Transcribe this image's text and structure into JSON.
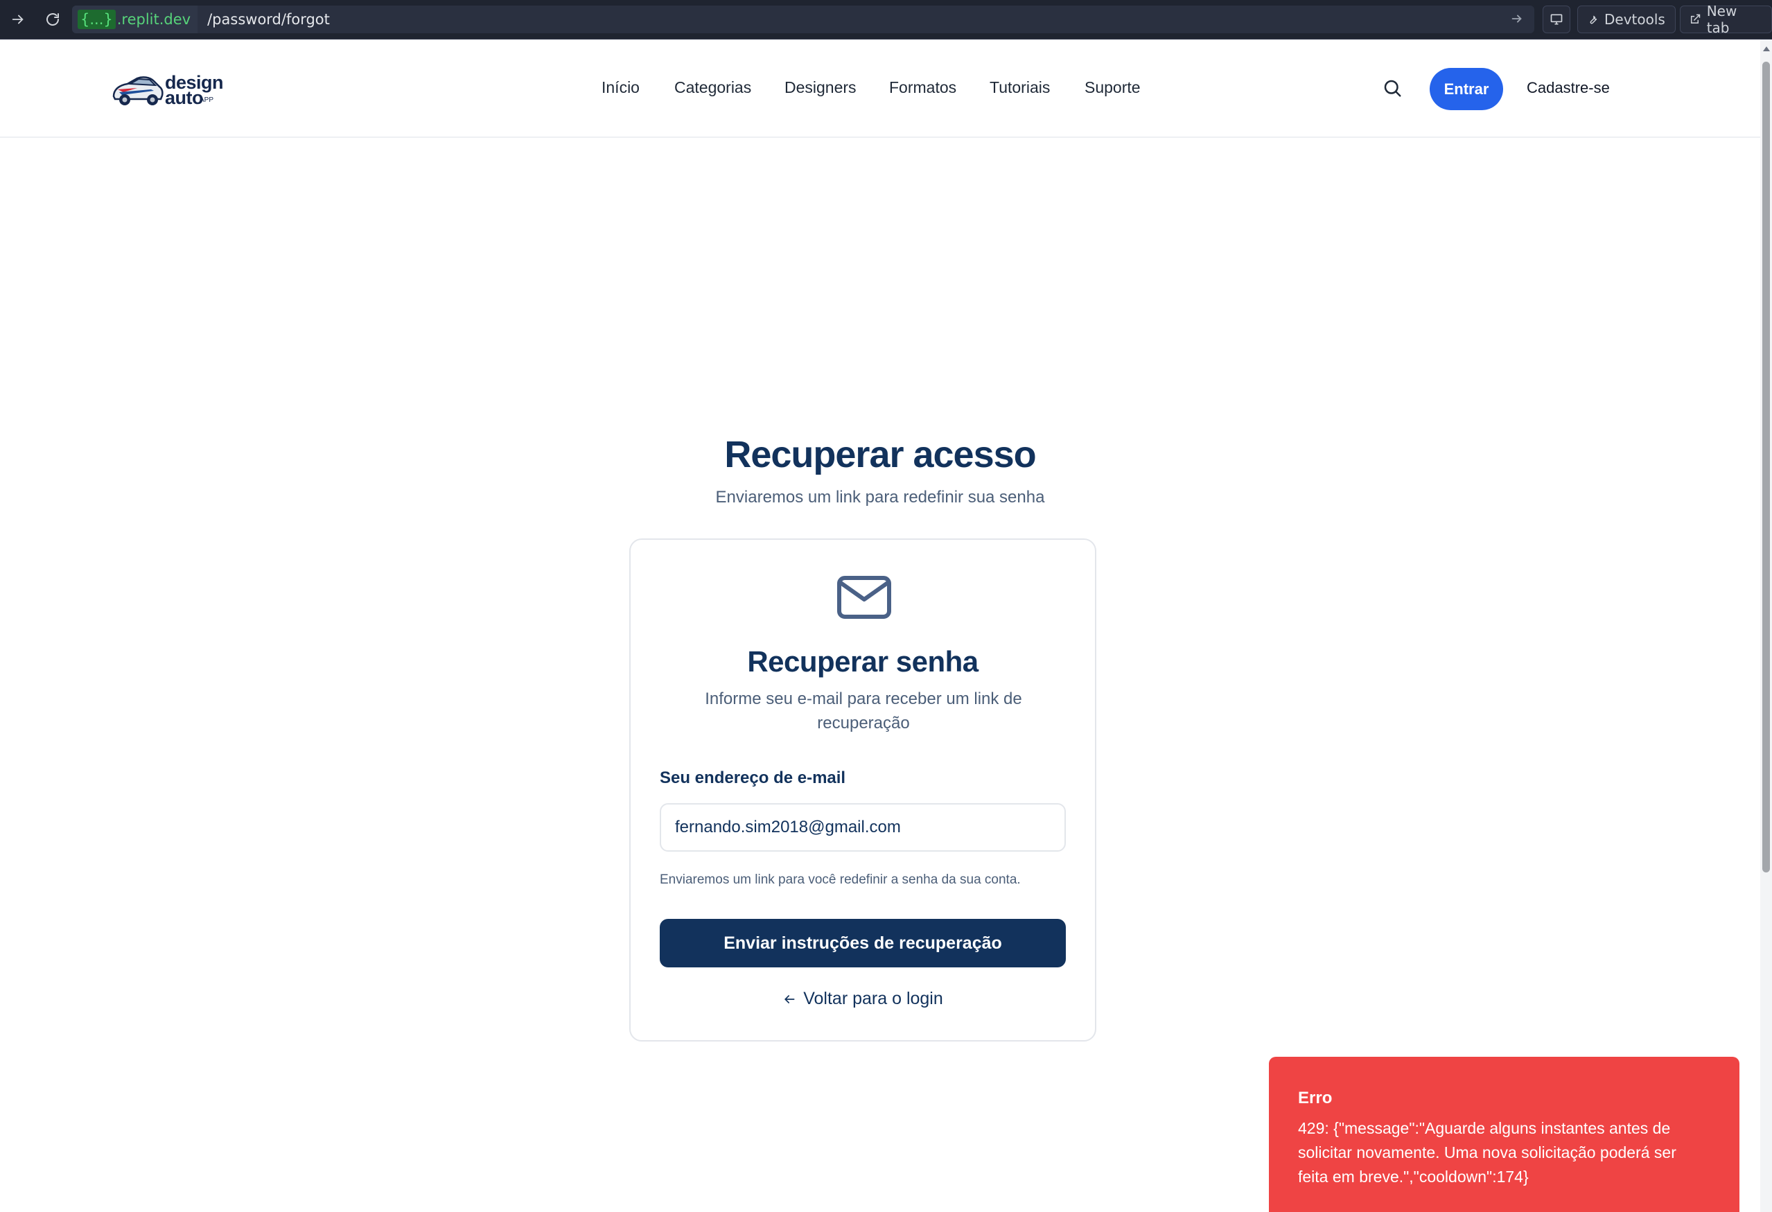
{
  "browser": {
    "url_host_braces": "{...}",
    "url_host": ".replit.dev",
    "url_path": "/password/forgot",
    "devtools_label": "Devtools",
    "newtab_label": "New tab"
  },
  "header": {
    "logo": {
      "line1": "design",
      "line2": "auto",
      "suffix": "APP"
    },
    "nav": [
      "Início",
      "Categorias",
      "Designers",
      "Formatos",
      "Tutoriais",
      "Suporte"
    ],
    "login_label": "Entrar",
    "signup_label": "Cadastre-se"
  },
  "main": {
    "title": "Recuperar acesso",
    "subtitle": "Enviaremos um link para redefinir sua senha"
  },
  "card": {
    "title": "Recuperar senha",
    "description": "Informe seu e-mail para receber um link de recuperação",
    "email_label": "Seu endereço de e-mail",
    "email_value": "fernando.sim2018@gmail.com",
    "help_text": "Enviaremos um link para você redefinir a senha da sua conta.",
    "submit_label": "Enviar instruções de recuperação",
    "back_label": "Voltar para o login"
  },
  "toast": {
    "title": "Erro",
    "message": "429: {\"message\":\"Aguarde alguns instantes antes de solicitar novamente. Uma nova solicitação poderá ser feita em breve.\",\"cooldown\":174}"
  },
  "colors": {
    "primary_blue": "#2563eb",
    "navy": "#12325c",
    "error_red": "#ef4444"
  }
}
